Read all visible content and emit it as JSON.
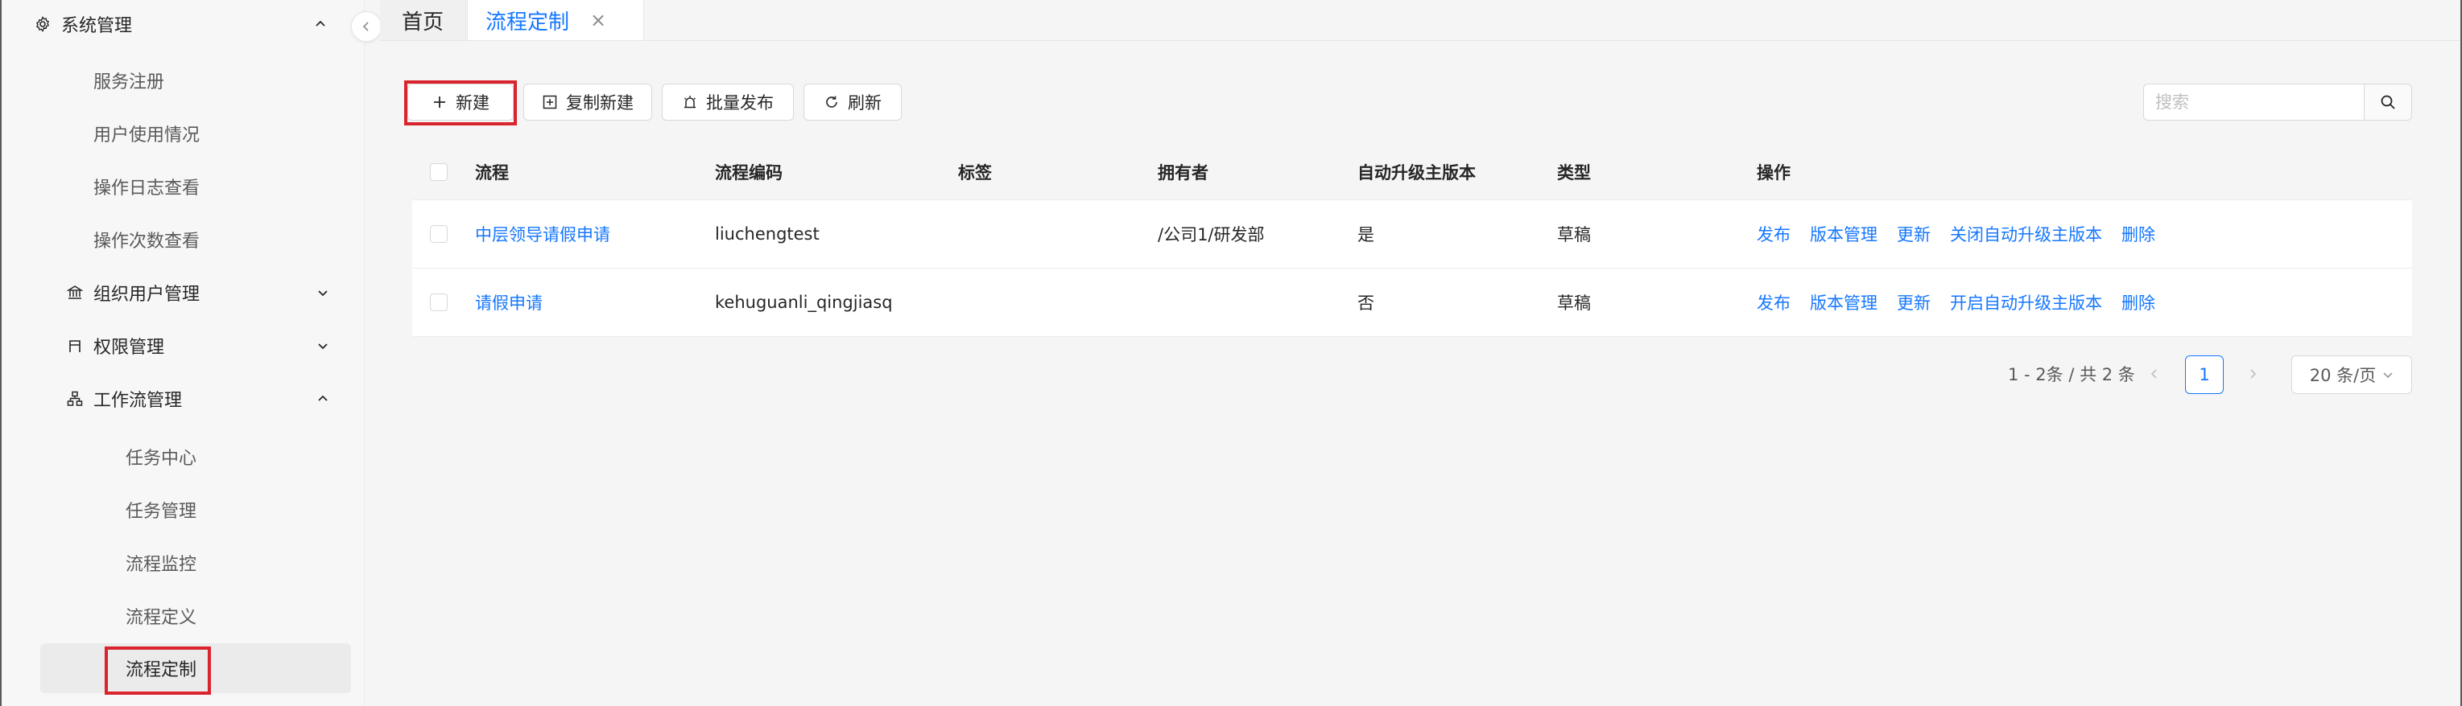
{
  "sidebar": {
    "groups": [
      {
        "label": "系统管理",
        "icon": "gear-icon",
        "expanded": true
      },
      {
        "label": "组织用户管理",
        "icon": "bank-icon",
        "expanded": false
      },
      {
        "label": "权限管理",
        "icon": "gate-icon",
        "expanded": false
      },
      {
        "label": "工作流管理",
        "icon": "workflow-icon",
        "expanded": true
      }
    ],
    "system_items": [
      "服务注册",
      "用户使用情况",
      "操作日志查看",
      "操作次数查看"
    ],
    "workflow_items": [
      "任务中心",
      "任务管理",
      "流程监控",
      "流程定义",
      "流程定制"
    ],
    "selected": "流程定制"
  },
  "tabs": {
    "home": "首页",
    "active": "流程定制",
    "close": "×"
  },
  "toolbar": {
    "new": "新建",
    "copy_new": "复制新建",
    "batch_publish": "批量发布",
    "refresh": "刷新",
    "search_placeholder": "搜索"
  },
  "table": {
    "columns": [
      "流程",
      "流程编码",
      "标签",
      "拥有者",
      "自动升级主版本",
      "类型",
      "操作"
    ],
    "rows": [
      {
        "name": "中层领导请假申请",
        "code": "liuchengtest",
        "tag": "",
        "owner": "/公司1/研发部",
        "auto_upgrade": "是",
        "type": "草稿",
        "actions": [
          "发布",
          "版本管理",
          "更新",
          "关闭自动升级主版本",
          "删除"
        ]
      },
      {
        "name": "请假申请",
        "code": "kehuguanli_qingjiasq",
        "tag": "",
        "owner": "",
        "auto_upgrade": "否",
        "type": "草稿",
        "actions": [
          "发布",
          "版本管理",
          "更新",
          "开启自动升级主版本",
          "删除"
        ]
      }
    ]
  },
  "pagination": {
    "total": "1 - 2条 / 共 2 条",
    "current": "1",
    "page_size": "20 条/页"
  },
  "colors": {
    "primary": "#1677ff",
    "highlight": "#d9232d",
    "selected_bg": "#ebebeb"
  }
}
